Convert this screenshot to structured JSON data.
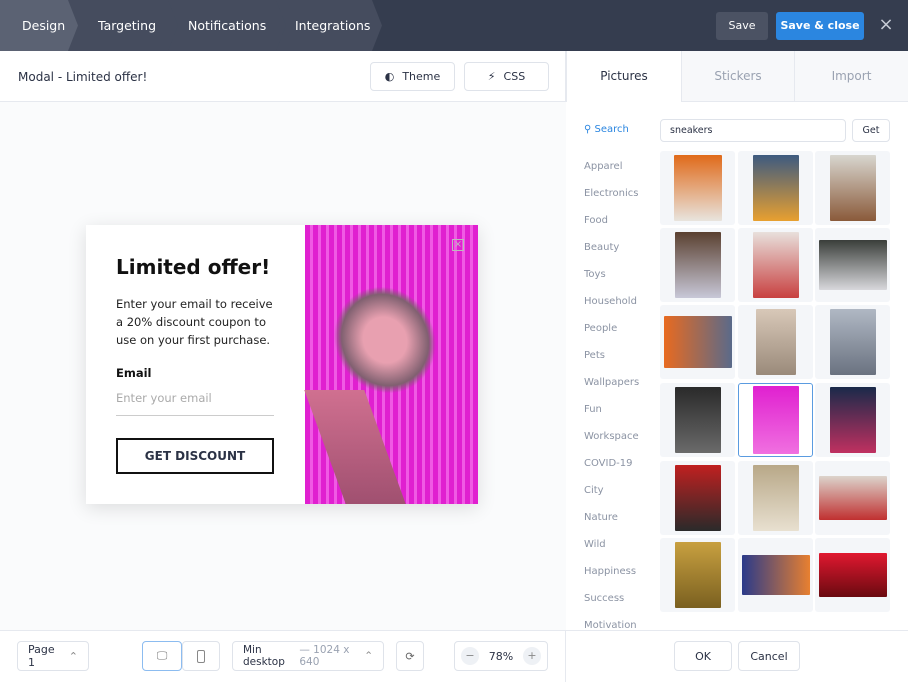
{
  "steps": [
    "Design",
    "Targeting",
    "Notifications",
    "Integrations"
  ],
  "header": {
    "save": "Save",
    "save_close": "Save & close",
    "close": "×"
  },
  "editor": {
    "title": "Modal - Limited offer!",
    "theme": "Theme",
    "css": "CSS"
  },
  "modal": {
    "heading": "Limited offer!",
    "body": "Enter your email to receive a 20% discount coupon to use on your first purchase.",
    "email_label": "Email",
    "email_placeholder": "Enter your email",
    "button": "GET DISCOUNT",
    "close": "×"
  },
  "footer": {
    "page": "Page 1",
    "device": "Min desktop",
    "size": "— 1024 x 640",
    "zoom": "78%",
    "minus": "−",
    "plus": "+"
  },
  "right": {
    "tabs": [
      "Pictures",
      "Stickers",
      "Import"
    ],
    "search_label": "Search",
    "search_value": "sneakers",
    "get": "Get",
    "ok": "OK",
    "cancel": "Cancel",
    "categories": [
      "Apparel",
      "Electronics",
      "Food",
      "Beauty",
      "Toys",
      "Household",
      "People",
      "Pets",
      "Wallpapers",
      "Fun",
      "Workspace",
      "COVID-19",
      "City",
      "Nature",
      "Wild",
      "Happiness",
      "Success",
      "Motivation"
    ]
  },
  "colors": {
    "accent": "#2b86e0",
    "topbar": "#353d4f",
    "modal_image": "#e020d0"
  },
  "thumbs": [
    {
      "c": "linear-gradient(#e06a1a,#e8e4de)",
      "w": 48,
      "h": 66
    },
    {
      "c": "linear-gradient(#3d5a80,#e8a030)",
      "w": 46,
      "h": 66
    },
    {
      "c": "linear-gradient(#d8d6cf,#8a5a3a)",
      "w": 46,
      "h": 66
    },
    {
      "c": "linear-gradient(#5a4030,#c8c8d8)",
      "w": 46,
      "h": 66
    },
    {
      "c": "linear-gradient(#e8e0dc,#c84040)",
      "w": 46,
      "h": 66
    },
    {
      "c": "linear-gradient(#3a3e3a,#d8d8dc)",
      "w": 68,
      "h": 50
    },
    {
      "c": "linear-gradient(90deg,#e86a20,#5a6a8a)",
      "w": 68,
      "h": 52
    },
    {
      "c": "linear-gradient(#d8c8b8,#9a8a7a)",
      "w": 40,
      "h": 66
    },
    {
      "c": "linear-gradient(#b0b8c4,#6a7280)",
      "w": 46,
      "h": 66
    },
    {
      "c": "linear-gradient(#2a2a2a,#6a6a6a)",
      "w": 46,
      "h": 66
    },
    {
      "c": "linear-gradient(#e020d0,#f070e0)",
      "w": 46,
      "h": 68
    },
    {
      "c": "linear-gradient(#1a2a4a,#c03060)",
      "w": 46,
      "h": 66
    },
    {
      "c": "linear-gradient(#c02020,#2a2a2a)",
      "w": 46,
      "h": 66
    },
    {
      "c": "linear-gradient(#b8a888,#e8e0d0)",
      "w": 46,
      "h": 66
    },
    {
      "c": "linear-gradient(#dcd4cc,#c03030)",
      "w": 68,
      "h": 44
    },
    {
      "c": "linear-gradient(#c8a040,#7a6020)",
      "w": 46,
      "h": 66
    },
    {
      "c": "linear-gradient(90deg,#2a3a8a,#e88030)",
      "w": 68,
      "h": 40
    },
    {
      "c": "linear-gradient(#e01830,#6a0a10)",
      "w": 68,
      "h": 44
    }
  ]
}
